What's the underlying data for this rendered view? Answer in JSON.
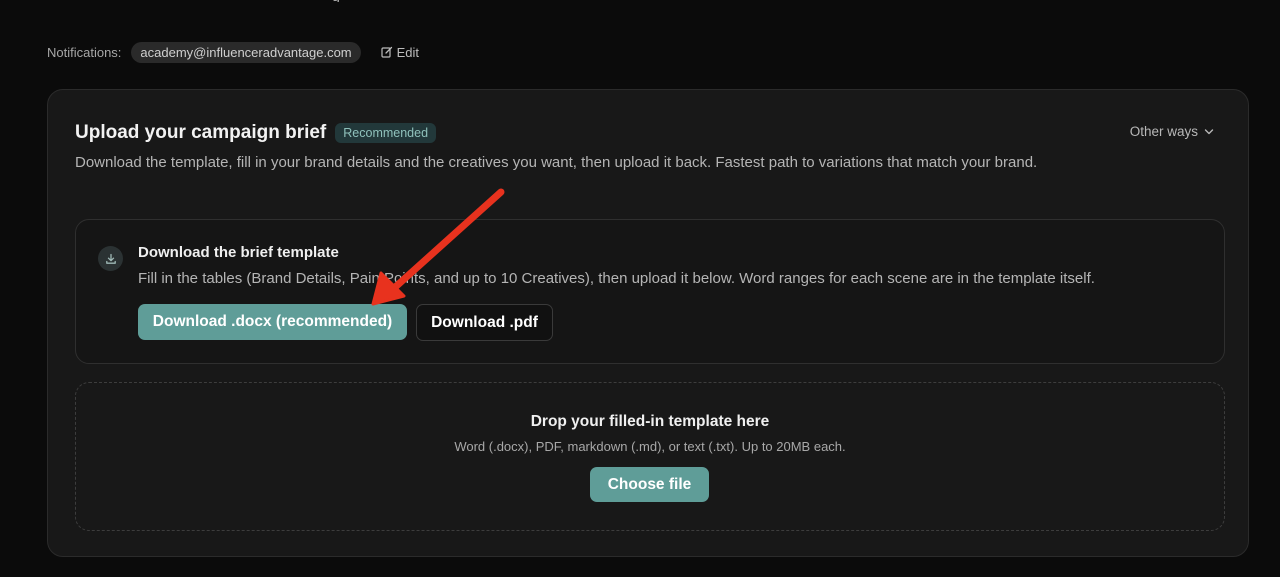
{
  "top_cut_text": "g",
  "notifications": {
    "label": "Notifications:",
    "email": "academy@influenceradvantage.com",
    "edit_label": "Edit"
  },
  "card": {
    "title": "Upload your campaign brief",
    "badge": "Recommended",
    "other_ways_label": "Other ways",
    "description": "Download the template, fill in your brand details and the creatives you want, then upload it back. Fastest path to variations that match your brand."
  },
  "template": {
    "title": "Download the brief template",
    "description": "Fill in the tables (Brand Details, Pain Points, and up to 10 Creatives), then upload it below. Word ranges for each scene are in the template itself.",
    "download_docx_label": "Download .docx (recommended)",
    "download_pdf_label": "Download .pdf"
  },
  "dropzone": {
    "title": "Drop your filled-in template here",
    "subtitle": "Word (.docx), PDF, markdown (.md), or text (.txt). Up to 20MB each.",
    "choose_label": "Choose file"
  },
  "colors": {
    "accent": "#5f9d98",
    "annotation_arrow": "#e8321e",
    "background": "#0b0b0b",
    "card": "#181818"
  },
  "icons": {
    "edit": "edit-icon",
    "chevron": "chevron-down-icon",
    "download": "download-icon"
  }
}
